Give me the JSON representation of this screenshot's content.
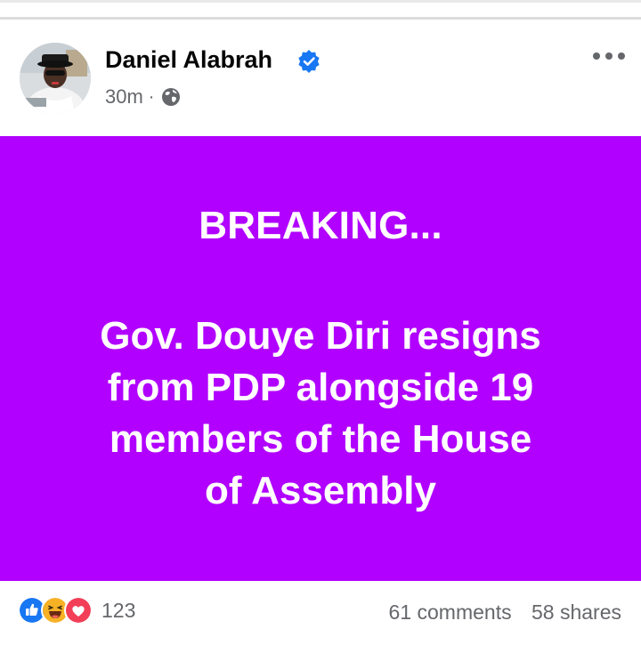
{
  "post": {
    "author": {
      "name": "Daniel Alabrah",
      "verified": true
    },
    "meta": {
      "time": "30m",
      "separator": "·",
      "audience_icon": "globe-icon"
    },
    "banner": {
      "background_color": "#b100ff",
      "text_color": "#ffffff",
      "headline": "BREAKING...",
      "lines": [
        "Gov. Douye Diri resigns",
        "from PDP alongside 19",
        "members of the House",
        "of Assembly"
      ]
    },
    "footer": {
      "reaction_icons": [
        "like-icon",
        "haha-icon",
        "love-icon"
      ],
      "reaction_count": "123",
      "comments": "61 comments",
      "shares": "58 shares"
    }
  },
  "colors": {
    "verified_badge": "#1877f2",
    "meta_text": "#65676b",
    "like": "#1877f2",
    "haha": "#f7b125",
    "love": "#f33e58"
  }
}
